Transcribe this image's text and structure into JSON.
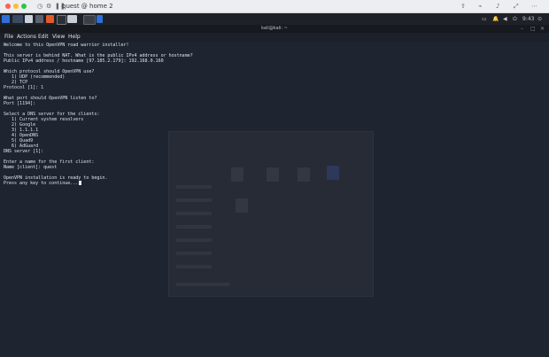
{
  "vm_window": {
    "title": "quest @ home 2",
    "traffic_colors": [
      "#ff5f57",
      "#febc2e",
      "#28c840"
    ]
  },
  "kali_panel": {
    "clock": "9:43",
    "icons": [
      "kali-menu-icon",
      "workspace-1-icon",
      "workspace-2-icon",
      "file-manager-icon",
      "firefox-icon",
      "terminal-icon",
      "notes-icon",
      "terminal-window-icon",
      "blue-app-icon"
    ]
  },
  "terminal": {
    "title": "kali@kali: ~",
    "menu": [
      "File",
      "Actions",
      "Edit",
      "View",
      "Help"
    ],
    "lines": [
      "Welcome to this OpenVPN road warrior installer!",
      "",
      "This server is behind NAT. What is the public IPv4 address or hostname?",
      "Public IPv4 address / hostname [97.185.2.179]: 192.168.0.160",
      "",
      "Which protocol should OpenVPN use?",
      "   1) UDP (recommended)",
      "   2) TCP",
      "Protocol [1]: 1",
      "",
      "What port should OpenVPN listen to?",
      "Port [1194]:",
      "",
      "Select a DNS server for the clients:",
      "   1) Current system resolvers",
      "   2) Google",
      "   3) 1.1.1.1",
      "   4) OpenDNS",
      "   5) Quad9",
      "   6) AdGuard",
      "DNS server [1]:",
      "",
      "Enter a name for the first client:",
      "Name [client]: quest",
      "",
      "OpenVPN installation is ready to begin.",
      "Press any key to continue..."
    ]
  }
}
